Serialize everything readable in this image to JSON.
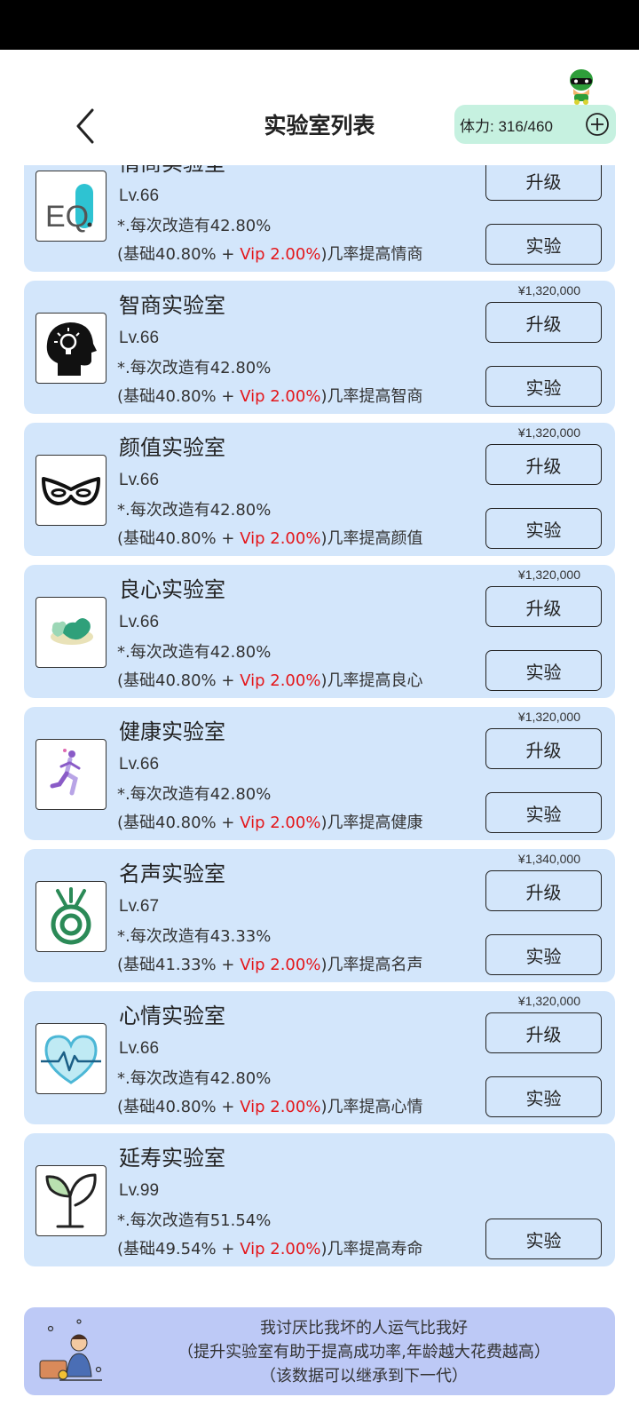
{
  "header": {
    "title": "实验室列表",
    "stamina": "体力: 316/460"
  },
  "labs": [
    {
      "name": "情商实验室",
      "level": "Lv.66",
      "rate": "*.每次改造有42.80%",
      "base": "(基础40.80% + ",
      "vip": "Vip 2.00%",
      "suffix": ")几率提高情商",
      "price": "",
      "upgrade": "升级",
      "experiment": "实验",
      "icon": "eq-icon"
    },
    {
      "name": "智商实验室",
      "level": "Lv.66",
      "rate": "*.每次改造有42.80%",
      "base": "(基础40.80% + ",
      "vip": "Vip 2.00%",
      "suffix": ")几率提高智商",
      "price": "¥1,320,000",
      "upgrade": "升级",
      "experiment": "实验",
      "icon": "head-bulb-icon"
    },
    {
      "name": "颜值实验室",
      "level": "Lv.66",
      "rate": "*.每次改造有42.80%",
      "base": "(基础40.80% + ",
      "vip": "Vip 2.00%",
      "suffix": ")几率提高颜值",
      "price": "¥1,320,000",
      "upgrade": "升级",
      "experiment": "实验",
      "icon": "mask-icon"
    },
    {
      "name": "良心实验室",
      "level": "Lv.66",
      "rate": "*.每次改造有42.80%",
      "base": "(基础40.80% + ",
      "vip": "Vip 2.00%",
      "suffix": ")几率提高良心",
      "price": "¥1,320,000",
      "upgrade": "升级",
      "experiment": "实验",
      "icon": "hearts-icon"
    },
    {
      "name": "健康实验室",
      "level": "Lv.66",
      "rate": "*.每次改造有42.80%",
      "base": "(基础40.80% + ",
      "vip": "Vip 2.00%",
      "suffix": ")几率提高健康",
      "price": "¥1,320,000",
      "upgrade": "升级",
      "experiment": "实验",
      "icon": "runner-icon"
    },
    {
      "name": "名声实验室",
      "level": "Lv.67",
      "rate": "*.每次改造有43.33%",
      "base": "(基础41.33% + ",
      "vip": "Vip 2.00%",
      "suffix": ")几率提高名声",
      "price": "¥1,340,000",
      "upgrade": "升级",
      "experiment": "实验",
      "icon": "medal-icon"
    },
    {
      "name": "心情实验室",
      "level": "Lv.66",
      "rate": "*.每次改造有42.80%",
      "base": "(基础40.80% + ",
      "vip": "Vip 2.00%",
      "suffix": ")几率提高心情",
      "price": "¥1,320,000",
      "upgrade": "升级",
      "experiment": "实验",
      "icon": "heart-pulse-icon"
    },
    {
      "name": "延寿实验室",
      "level": "Lv.99",
      "rate": "*.每次改造有51.54%",
      "base": "(基础49.54% + ",
      "vip": "Vip 2.00%",
      "suffix": ")几率提高寿命",
      "price": "",
      "upgrade": "",
      "experiment": "实验",
      "icon": "sprout-icon"
    }
  ],
  "footer": {
    "line1": "我讨厌比我坏的人运气比我好",
    "line2": "（提升实验室有助于提高成功率,年龄越大花费越高）",
    "line3": "（该数据可以继承到下一代）"
  }
}
